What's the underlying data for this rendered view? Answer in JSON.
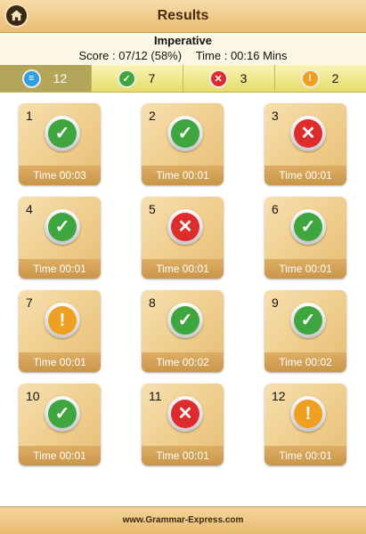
{
  "header": {
    "title": "Results",
    "home_icon": "home-icon"
  },
  "info": {
    "topic": "Imperative",
    "score": "Score : 07/12 (58%)",
    "time": "Time :  00:16 Mins"
  },
  "stats": [
    {
      "name": "total",
      "icon": "list-icon",
      "glyph": "≡",
      "color": "#2e9fe0",
      "value": "12",
      "active": true
    },
    {
      "name": "correct",
      "icon": "check-icon",
      "glyph": "✓",
      "color": "#3fa63f",
      "value": "7",
      "active": false
    },
    {
      "name": "wrong",
      "icon": "cross-icon",
      "glyph": "✕",
      "color": "#de2b2b",
      "value": "3",
      "active": false
    },
    {
      "name": "skipped",
      "icon": "exclamation-icon",
      "glyph": "!",
      "color": "#f0a020",
      "value": "2",
      "active": false
    }
  ],
  "colors": {
    "correct": "#3fa63f",
    "wrong": "#de2b2b",
    "skipped": "#f0a020"
  },
  "questions": [
    {
      "num": "1",
      "status": "correct",
      "time": "Time 00:03"
    },
    {
      "num": "2",
      "status": "correct",
      "time": "Time 00:01"
    },
    {
      "num": "3",
      "status": "wrong",
      "time": "Time 00:01"
    },
    {
      "num": "4",
      "status": "correct",
      "time": "Time 00:01"
    },
    {
      "num": "5",
      "status": "wrong",
      "time": "Time 00:01"
    },
    {
      "num": "6",
      "status": "correct",
      "time": "Time 00:01"
    },
    {
      "num": "7",
      "status": "skipped",
      "time": "Time 00:01"
    },
    {
      "num": "8",
      "status": "correct",
      "time": "Time 00:02"
    },
    {
      "num": "9",
      "status": "correct",
      "time": "Time 00:02"
    },
    {
      "num": "10",
      "status": "correct",
      "time": "Time 00:01"
    },
    {
      "num": "11",
      "status": "wrong",
      "time": "Time 00:01"
    },
    {
      "num": "12",
      "status": "skipped",
      "time": "Time 00:01"
    }
  ],
  "footer": {
    "text": "www.Grammar-Express.com"
  }
}
